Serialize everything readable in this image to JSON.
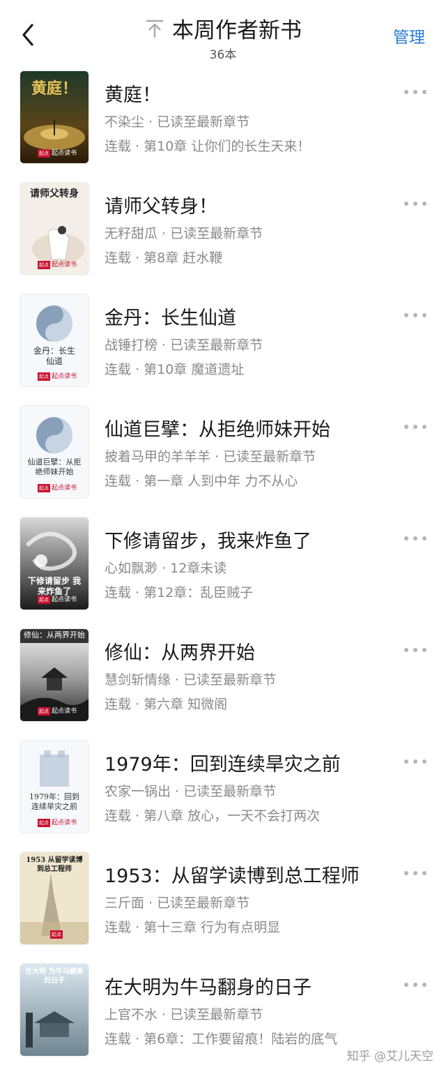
{
  "header": {
    "title": "本周作者新书",
    "count": "36本",
    "manage_label": "管理"
  },
  "books": [
    {
      "title": "黄庭！",
      "meta": "不染尘 · 已读至最新章节",
      "chapter": "连载 · 第10章 让你们的长生天来！",
      "cover_text": "黄庭！"
    },
    {
      "title": "请师父转身！",
      "meta": "无籽甜瓜 · 已读至最新章节",
      "chapter": "连载 · 第8章 赶水鞭",
      "cover_text": "请师父转身"
    },
    {
      "title": "金丹：长生仙道",
      "meta": "战锤打榜 · 已读至最新章节",
      "chapter": "连载 · 第10章 魔道遗址",
      "cover_text": "金丹：长生仙道"
    },
    {
      "title": "仙道巨擘：从拒绝师妹开始",
      "meta": "披着马甲的羊羊羊 · 已读至最新章节",
      "chapter": "连载 · 第一章 人到中年 力不从心",
      "cover_text": "仙道巨擘：从拒绝师妹开始"
    },
    {
      "title": "下修请留步，我来炸鱼了",
      "meta": "心如飘渺 · 12章未读",
      "chapter": "连载 · 第12章：乱臣贼子",
      "cover_text": "下修请留步 我来炸鱼了"
    },
    {
      "title": "修仙：从两界开始",
      "meta": "慧剑斩情缘 · 已读至最新章节",
      "chapter": "连载 · 第六章 知微阁",
      "cover_text": "修仙：从两界开始"
    },
    {
      "title": "1979年：回到连续旱灾之前",
      "meta": "农家一锅出 · 已读至最新章节",
      "chapter": "连载 · 第八章 放心，一天不会打两次",
      "cover_text": "1979年：回到连续旱灾之前"
    },
    {
      "title": "1953：从留学读博到总工程师",
      "meta": "三斤面 · 已读至最新章节",
      "chapter": "连载 · 第十三章 行为有点明显",
      "cover_text": "1953 从留学读博到总工程师"
    },
    {
      "title": "在大明为牛马翻身的日子",
      "meta": "上官不水 · 已读至最新章节",
      "chapter": "连载 · 第6章：工作要留痕！陆岩的底气",
      "cover_text": "在大明 为牛马翻身的日子"
    }
  ],
  "cover_publisher": "起点读书",
  "watermark": "知乎 @艾儿天空",
  "colors": {
    "accent": "#2b7bd3",
    "text_secondary": "#8a8a8a"
  }
}
